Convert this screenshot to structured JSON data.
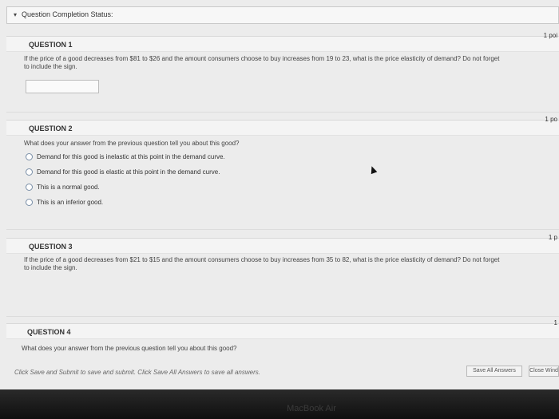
{
  "status": {
    "label": "Question Completion Status:"
  },
  "questions": [
    {
      "title": "QUESTION 1",
      "points": "1 poi",
      "text": "If the price of a good decreases from $81 to $26 and the amount consumers choose to buy increases from 19 to 23, what is the price elasticity of demand? Do not forget to include the sign."
    },
    {
      "title": "QUESTION 2",
      "points": "1 po",
      "text": "What does your answer from the previous question tell you about this good?",
      "options": [
        "Demand for this good is inelastic at this point in the demand curve.",
        "Demand for this good is elastic at this point in the demand curve.",
        "This is a normal good.",
        "This is an inferior good."
      ]
    },
    {
      "title": "QUESTION 3",
      "points": "1 p",
      "text": "If the price of a good decreases from $21 to $15 and the amount consumers choose to buy increases from 35 to 82, what is the price elasticity of demand? Do not forget to include the sign."
    },
    {
      "title": "QUESTION 4",
      "points": "1",
      "text": "What does your answer from the previous question tell you about this good?"
    }
  ],
  "footer": {
    "instruction": "Click Save and Submit to save and submit. Click Save All Answers to save all answers.",
    "save_all": "Save All Answers",
    "close": "Close Wind"
  },
  "bezel": {
    "brand": "MacBook Air"
  }
}
